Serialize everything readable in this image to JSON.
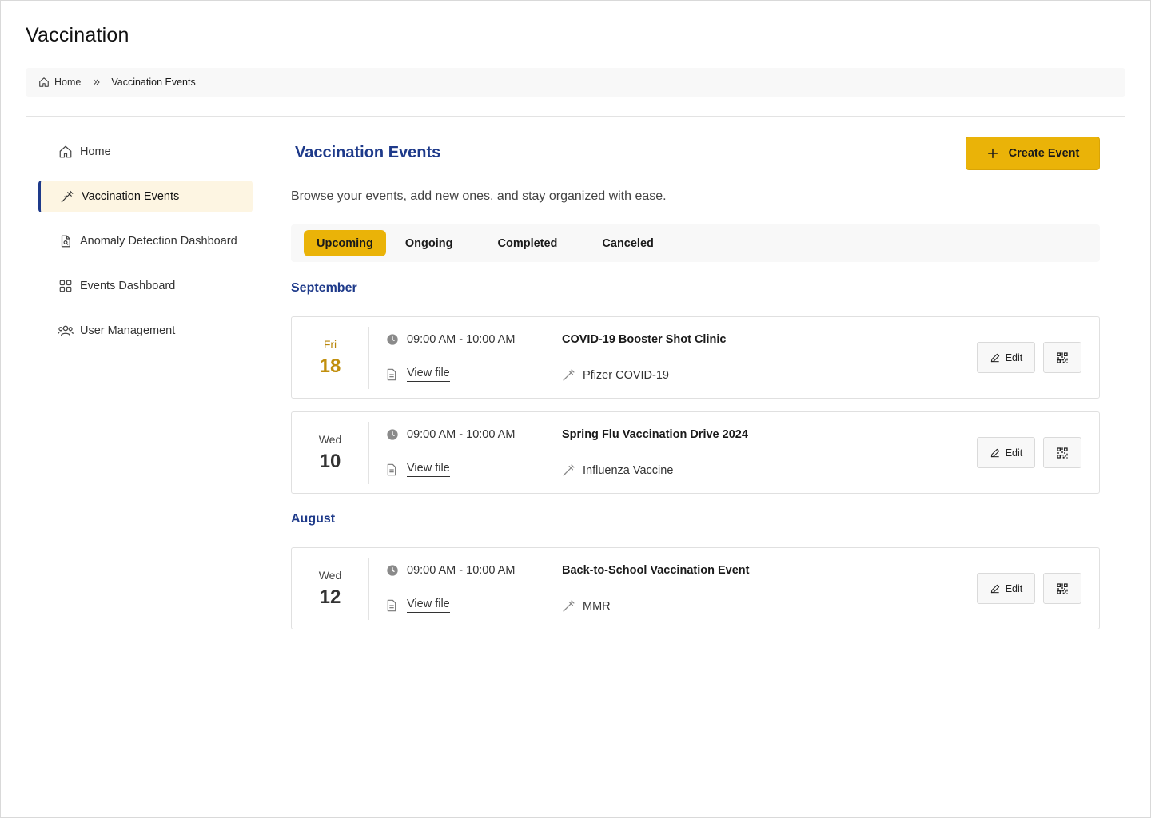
{
  "app_title": "Vaccination",
  "breadcrumb": {
    "home": "Home",
    "current": "Vaccination Events"
  },
  "sidebar": {
    "items": [
      {
        "label": "Home",
        "icon": "home-icon"
      },
      {
        "label": "Vaccination Events",
        "icon": "syringe-icon",
        "active": true
      },
      {
        "label": "Anomaly Detection Dashboard",
        "icon": "document-search-icon"
      },
      {
        "label": "Events Dashboard",
        "icon": "grid-icon"
      },
      {
        "label": "User Management",
        "icon": "users-icon"
      }
    ]
  },
  "main": {
    "title": "Vaccination Events",
    "create_label": "Create Event",
    "subtitle": "Browse your events, add new ones, and stay organized with ease.",
    "tabs": [
      {
        "label": "Upcoming",
        "active": true
      },
      {
        "label": "Ongoing"
      },
      {
        "label": "Completed"
      },
      {
        "label": "Canceled"
      }
    ]
  },
  "groups": [
    {
      "month": "September",
      "events": [
        {
          "dow": "Fri",
          "day": "18",
          "time": "09:00 AM - 10:00 AM",
          "file_label": "View file",
          "name": "COVID-19 Booster Shot Clinic",
          "vaccine": "Pfizer COVID-19",
          "edit_label": "Edit",
          "highlight": true
        },
        {
          "dow": "Wed",
          "day": "10",
          "time": "09:00 AM - 10:00 AM",
          "file_label": "View file",
          "name": "Spring Flu Vaccination Drive 2024",
          "vaccine": "Influenza Vaccine",
          "edit_label": "Edit"
        }
      ]
    },
    {
      "month": "August",
      "events": [
        {
          "dow": "Wed",
          "day": "12",
          "time": "09:00 AM - 10:00 AM",
          "file_label": "View file",
          "name": "Back-to-School Vaccination Event",
          "vaccine": "MMR",
          "edit_label": "Edit"
        }
      ]
    }
  ],
  "colors": {
    "accent": "#eab308",
    "brand": "#1e3a8a",
    "highlight_date": "#c18f0e"
  }
}
